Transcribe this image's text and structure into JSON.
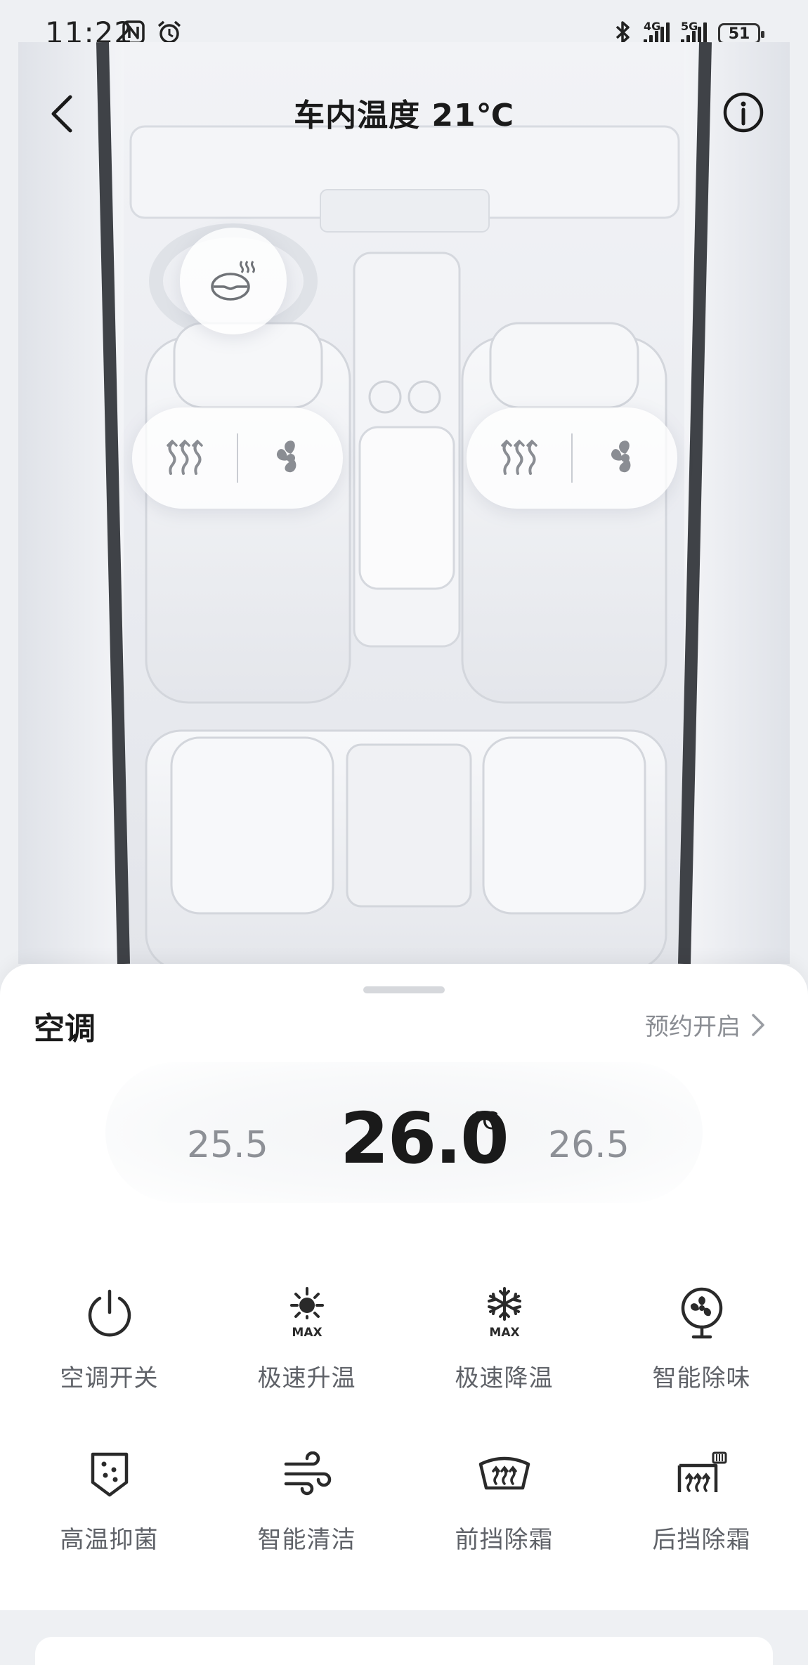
{
  "status_bar": {
    "time": "11:22",
    "left_icons": [
      "nfc-icon",
      "alarm-icon"
    ],
    "right_icons": [
      "bluetooth-icon",
      "signal-4g-icon",
      "signal-5g-icon"
    ],
    "signal_1_label": "4G",
    "signal_2_label": "5G",
    "battery": "51"
  },
  "header": {
    "title": "车内温度 21℃",
    "back_icon": "chevron-left-icon",
    "info_icon": "info-icon"
  },
  "car_controls": {
    "steering_wheel_heat_icon": "steering-wheel-heat-icon",
    "driver_seat": {
      "heat_icon": "seat-heat-icon",
      "fan_icon": "seat-ventilation-icon"
    },
    "passenger_seat": {
      "heat_icon": "seat-heat-icon",
      "fan_icon": "seat-ventilation-icon"
    }
  },
  "climate": {
    "section_title": "空调",
    "schedule_label": "预约开启",
    "temp_lower": "25.5",
    "temp_current": "26.0",
    "temp_unit": "℃",
    "temp_higher": "26.5"
  },
  "controls": [
    {
      "label": "空调开关",
      "icon": "power-icon"
    },
    {
      "label": "极速升温",
      "icon": "sun-max-icon"
    },
    {
      "label": "极速降温",
      "icon": "snowflake-max-icon"
    },
    {
      "label": "智能除味",
      "icon": "fan-icon"
    },
    {
      "label": "高温抑菌",
      "icon": "shield-dots-icon"
    },
    {
      "label": "智能清洁",
      "icon": "wind-icon"
    },
    {
      "label": "前挡除霜",
      "icon": "front-defrost-icon"
    },
    {
      "label": "后挡除霜",
      "icon": "rear-defrost-icon"
    }
  ],
  "colors": {
    "accent_text": "#1a1a1a",
    "secondary_text": "#8a8d93",
    "icon": "#2a2a2a"
  }
}
